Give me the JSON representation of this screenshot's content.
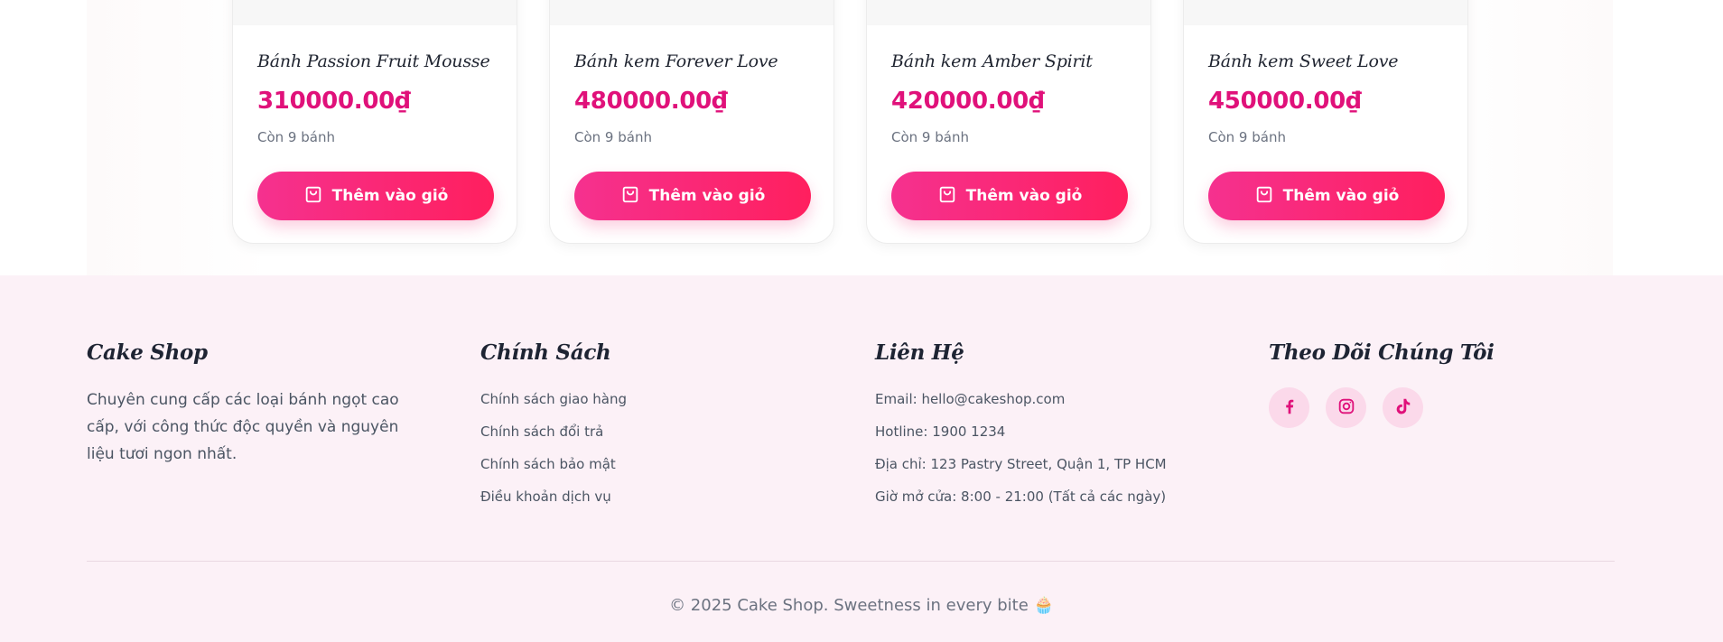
{
  "products": [
    {
      "name": "Bánh Passion Fruit Mousse",
      "price": "310000.00₫",
      "stock": "Còn 9 bánh",
      "button_label": "Thêm vào giỏ"
    },
    {
      "name": "Bánh kem Forever Love",
      "price": "480000.00₫",
      "stock": "Còn 9 bánh",
      "button_label": "Thêm vào giỏ"
    },
    {
      "name": "Bánh kem Amber Spirit",
      "price": "420000.00₫",
      "stock": "Còn 9 bánh",
      "button_label": "Thêm vào giỏ"
    },
    {
      "name": "Bánh kem Sweet Love",
      "price": "450000.00₫",
      "stock": "Còn 9 bánh",
      "button_label": "Thêm vào giỏ"
    }
  ],
  "footer": {
    "about": {
      "heading": "Cake Shop",
      "description": "Chuyên cung cấp các loại bánh ngọt cao cấp, với công thức độc quyền và nguyên liệu tươi ngon nhất."
    },
    "policy": {
      "heading": "Chính Sách",
      "links": [
        "Chính sách giao hàng",
        "Chính sách đổi trả",
        "Chính sách bảo mật",
        "Điều khoản dịch vụ"
      ]
    },
    "contact": {
      "heading": "Liên Hệ",
      "lines": [
        "Email: hello@cakeshop.com",
        "Hotline: 1900 1234",
        "Địa chỉ: 123 Pastry Street, Quận 1, TP HCM",
        "Giờ mở cửa: 8:00 - 21:00 (Tất cả các ngày)"
      ]
    },
    "social": {
      "heading": "Theo Dõi Chúng Tôi",
      "icons": [
        "facebook-icon",
        "instagram-icon",
        "tiktok-icon"
      ]
    },
    "copyright": "© 2025 Cake Shop. Sweetness in every bite 🧁"
  },
  "colors": {
    "accent": "#e0117a",
    "button_gradient_start": "#f5318f",
    "button_gradient_end": "#ff1f5e",
    "footer_bg": "#fcf1f7",
    "social_bg": "#fbd9ea"
  }
}
